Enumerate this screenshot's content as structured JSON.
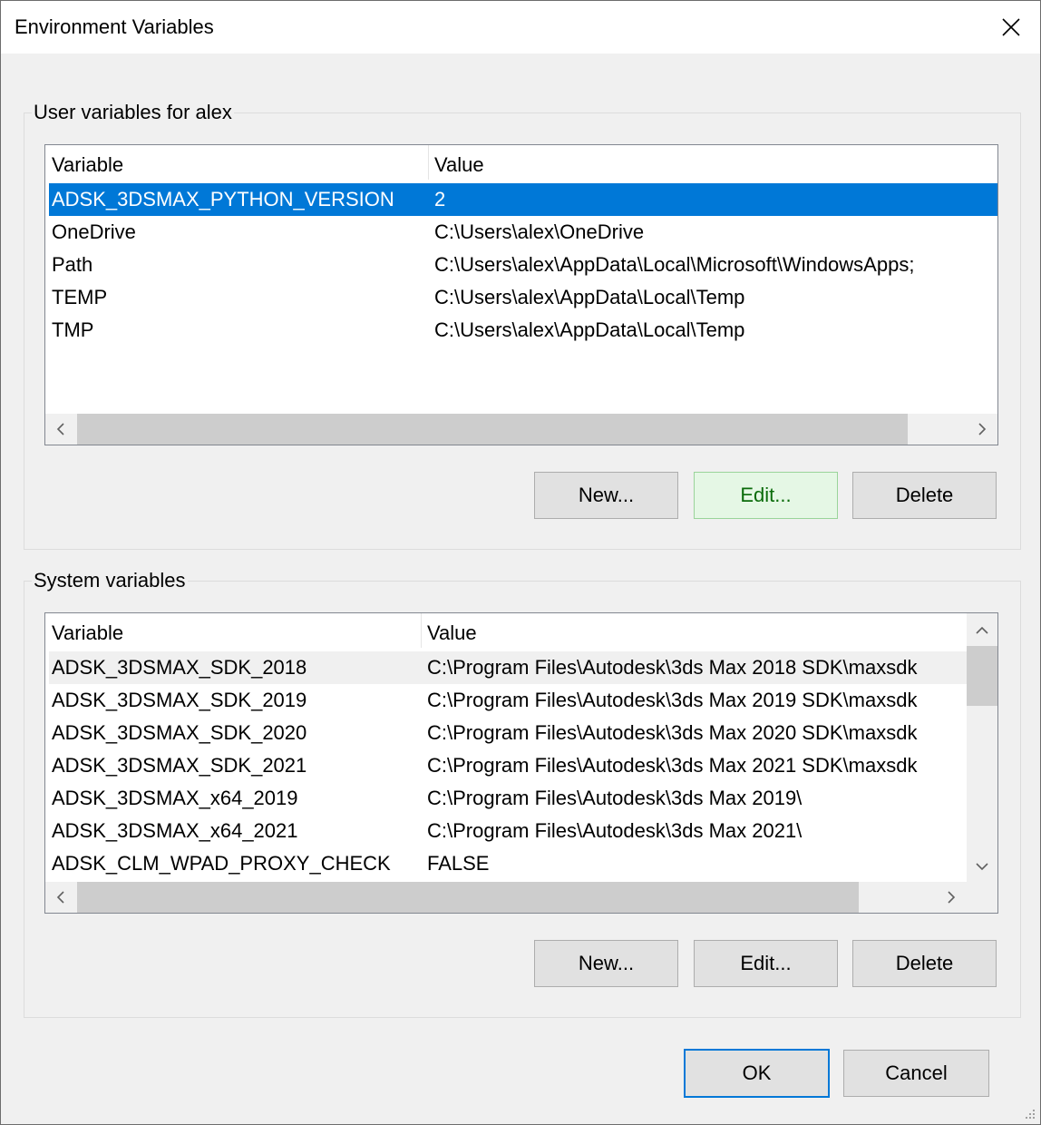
{
  "window": {
    "title": "Environment Variables"
  },
  "user_group": {
    "title": "User variables for alex",
    "columns": [
      "Variable",
      "Value"
    ],
    "rows": [
      {
        "variable": "ADSK_3DSMAX_PYTHON_VERSION",
        "value": "2",
        "selected": true
      },
      {
        "variable": "OneDrive",
        "value": "C:\\Users\\alex\\OneDrive"
      },
      {
        "variable": "Path",
        "value": "C:\\Users\\alex\\AppData\\Local\\Microsoft\\WindowsApps;"
      },
      {
        "variable": "TEMP",
        "value": "C:\\Users\\alex\\AppData\\Local\\Temp"
      },
      {
        "variable": "TMP",
        "value": "C:\\Users\\alex\\AppData\\Local\\Temp"
      }
    ],
    "buttons": {
      "new": "New...",
      "edit": "Edit...",
      "delete": "Delete"
    }
  },
  "system_group": {
    "title": "System variables",
    "columns": [
      "Variable",
      "Value"
    ],
    "rows": [
      {
        "variable": "ADSK_3DSMAX_SDK_2018",
        "value": "C:\\Program Files\\Autodesk\\3ds Max 2018 SDK\\maxsdk",
        "highlighted": true
      },
      {
        "variable": "ADSK_3DSMAX_SDK_2019",
        "value": "C:\\Program Files\\Autodesk\\3ds Max 2019 SDK\\maxsdk"
      },
      {
        "variable": "ADSK_3DSMAX_SDK_2020",
        "value": "C:\\Program Files\\Autodesk\\3ds Max 2020 SDK\\maxsdk"
      },
      {
        "variable": "ADSK_3DSMAX_SDK_2021",
        "value": "C:\\Program Files\\Autodesk\\3ds Max 2021 SDK\\maxsdk"
      },
      {
        "variable": "ADSK_3DSMAX_x64_2019",
        "value": "C:\\Program Files\\Autodesk\\3ds Max 2019\\"
      },
      {
        "variable": "ADSK_3DSMAX_x64_2021",
        "value": "C:\\Program Files\\Autodesk\\3ds Max 2021\\"
      },
      {
        "variable": "ADSK_CLM_WPAD_PROXY_CHECK",
        "value": "FALSE"
      }
    ],
    "buttons": {
      "new": "New...",
      "edit": "Edit...",
      "delete": "Delete"
    }
  },
  "footer": {
    "ok": "OK",
    "cancel": "Cancel"
  },
  "icons": {
    "close": "close-icon",
    "scroll_left": "chevron-left-icon",
    "scroll_right": "chevron-right-icon",
    "scroll_up": "chevron-up-icon",
    "scroll_down": "chevron-down-icon",
    "resize": "resize-grip-icon"
  },
  "colors": {
    "selection": "#0078d7",
    "hover_button": "#e5f7e5",
    "default_button_border": "#0078d7"
  }
}
